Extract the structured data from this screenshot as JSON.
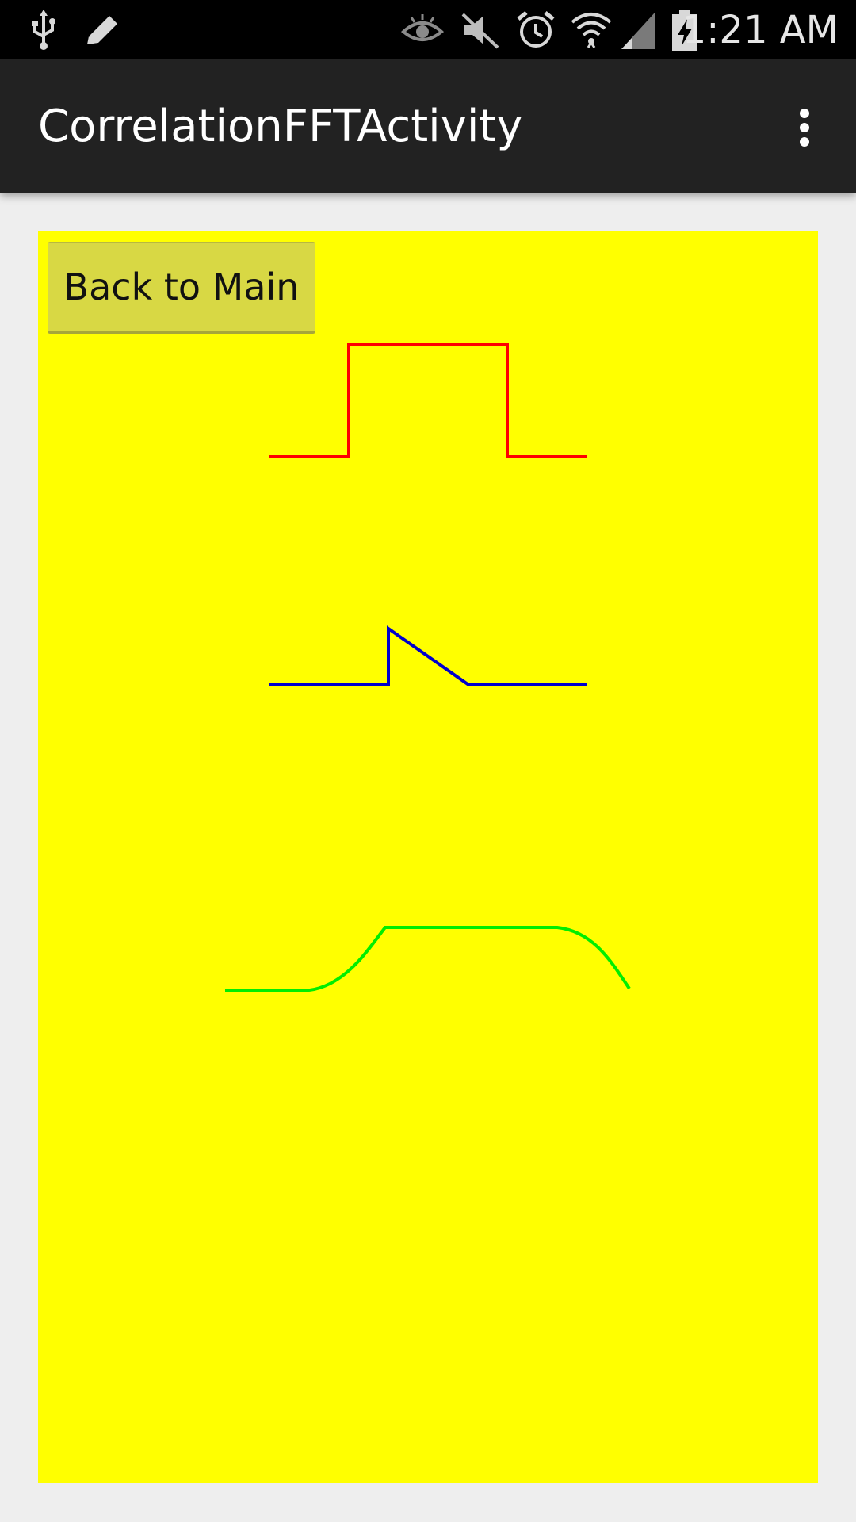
{
  "status_bar": {
    "time": "1:21 AM",
    "icons": [
      "usb-icon",
      "edit-icon",
      "eye-icon",
      "mute-icon",
      "alarm-icon",
      "wifi-icon",
      "signal-icon",
      "battery-charging-icon"
    ]
  },
  "action_bar": {
    "title": "CorrelationFFTActivity",
    "overflow_icon": "overflow-menu-icon"
  },
  "content": {
    "back_button_label": "Back to Main",
    "background_color": "#ffff00"
  },
  "signals": [
    {
      "color": "#ff0000"
    },
    {
      "color": "#0000cc"
    },
    {
      "color": "#00ee00"
    }
  ]
}
